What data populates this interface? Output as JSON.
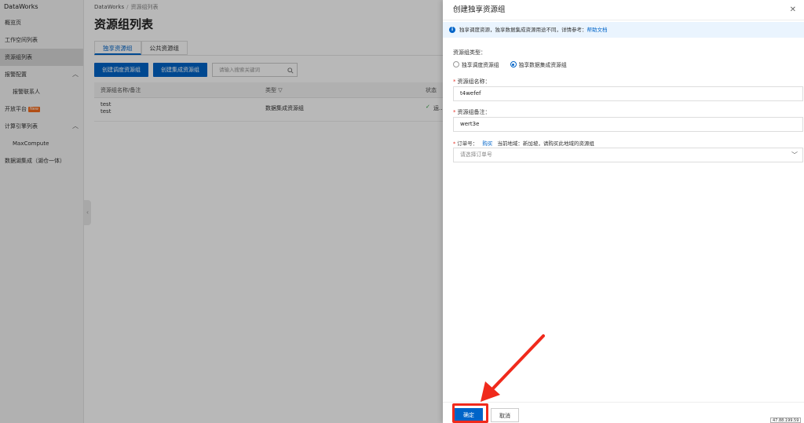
{
  "sidebar": {
    "brand": "DataWorks",
    "items": [
      {
        "label": "概览页"
      },
      {
        "label": "工作空间列表"
      },
      {
        "label": "资源组列表"
      },
      {
        "label": "报警配置"
      },
      {
        "label": "报警联系人"
      },
      {
        "label": "开放平台"
      },
      {
        "label": "计算引擎列表"
      },
      {
        "label": "MaxCompute"
      },
      {
        "label": "数据湖集成（湖仓一体）"
      }
    ],
    "new_badge": "New"
  },
  "main": {
    "breadcrumb": [
      "DataWorks",
      "资源组列表"
    ],
    "title": "资源组列表",
    "tabs": [
      {
        "label": "独享资源组"
      },
      {
        "label": "公共资源组"
      }
    ],
    "buttons": {
      "create_schedule": "创建调度资源组",
      "create_integration": "创建集成资源组"
    },
    "search_placeholder": "请输入搜索关键词",
    "table": {
      "headers": [
        "资源组名称/备注",
        "类型",
        "状态"
      ],
      "rows": [
        {
          "name": "test",
          "remark": "test",
          "type": "数据集成资源组",
          "status": "运..."
        }
      ]
    }
  },
  "drawer": {
    "title": "创建独享资源组",
    "info_text": "独享调度资源，独享数据集成资源用途不同，详情参考：",
    "info_link": "帮助文档",
    "type_label": "资源组类型：",
    "type_options": [
      {
        "label": "独享调度资源组",
        "checked": false
      },
      {
        "label": "独享数据集成资源组",
        "checked": true
      }
    ],
    "name_label": "资源组名称：",
    "name_value": "t4wefef",
    "remark_label": "资源组备注：",
    "remark_value": "wert3e",
    "order_label": "订单号：",
    "order_buy": "购买",
    "order_region": "当前地域：新加坡，请购买此地域的资源组",
    "order_placeholder": "请选择订单号",
    "ok_label": "确定",
    "cancel_label": "取消"
  },
  "ip_fragment": "47.88.199.59",
  "colors": {
    "primary": "#0064c8",
    "annotation": "#f02a1c"
  }
}
